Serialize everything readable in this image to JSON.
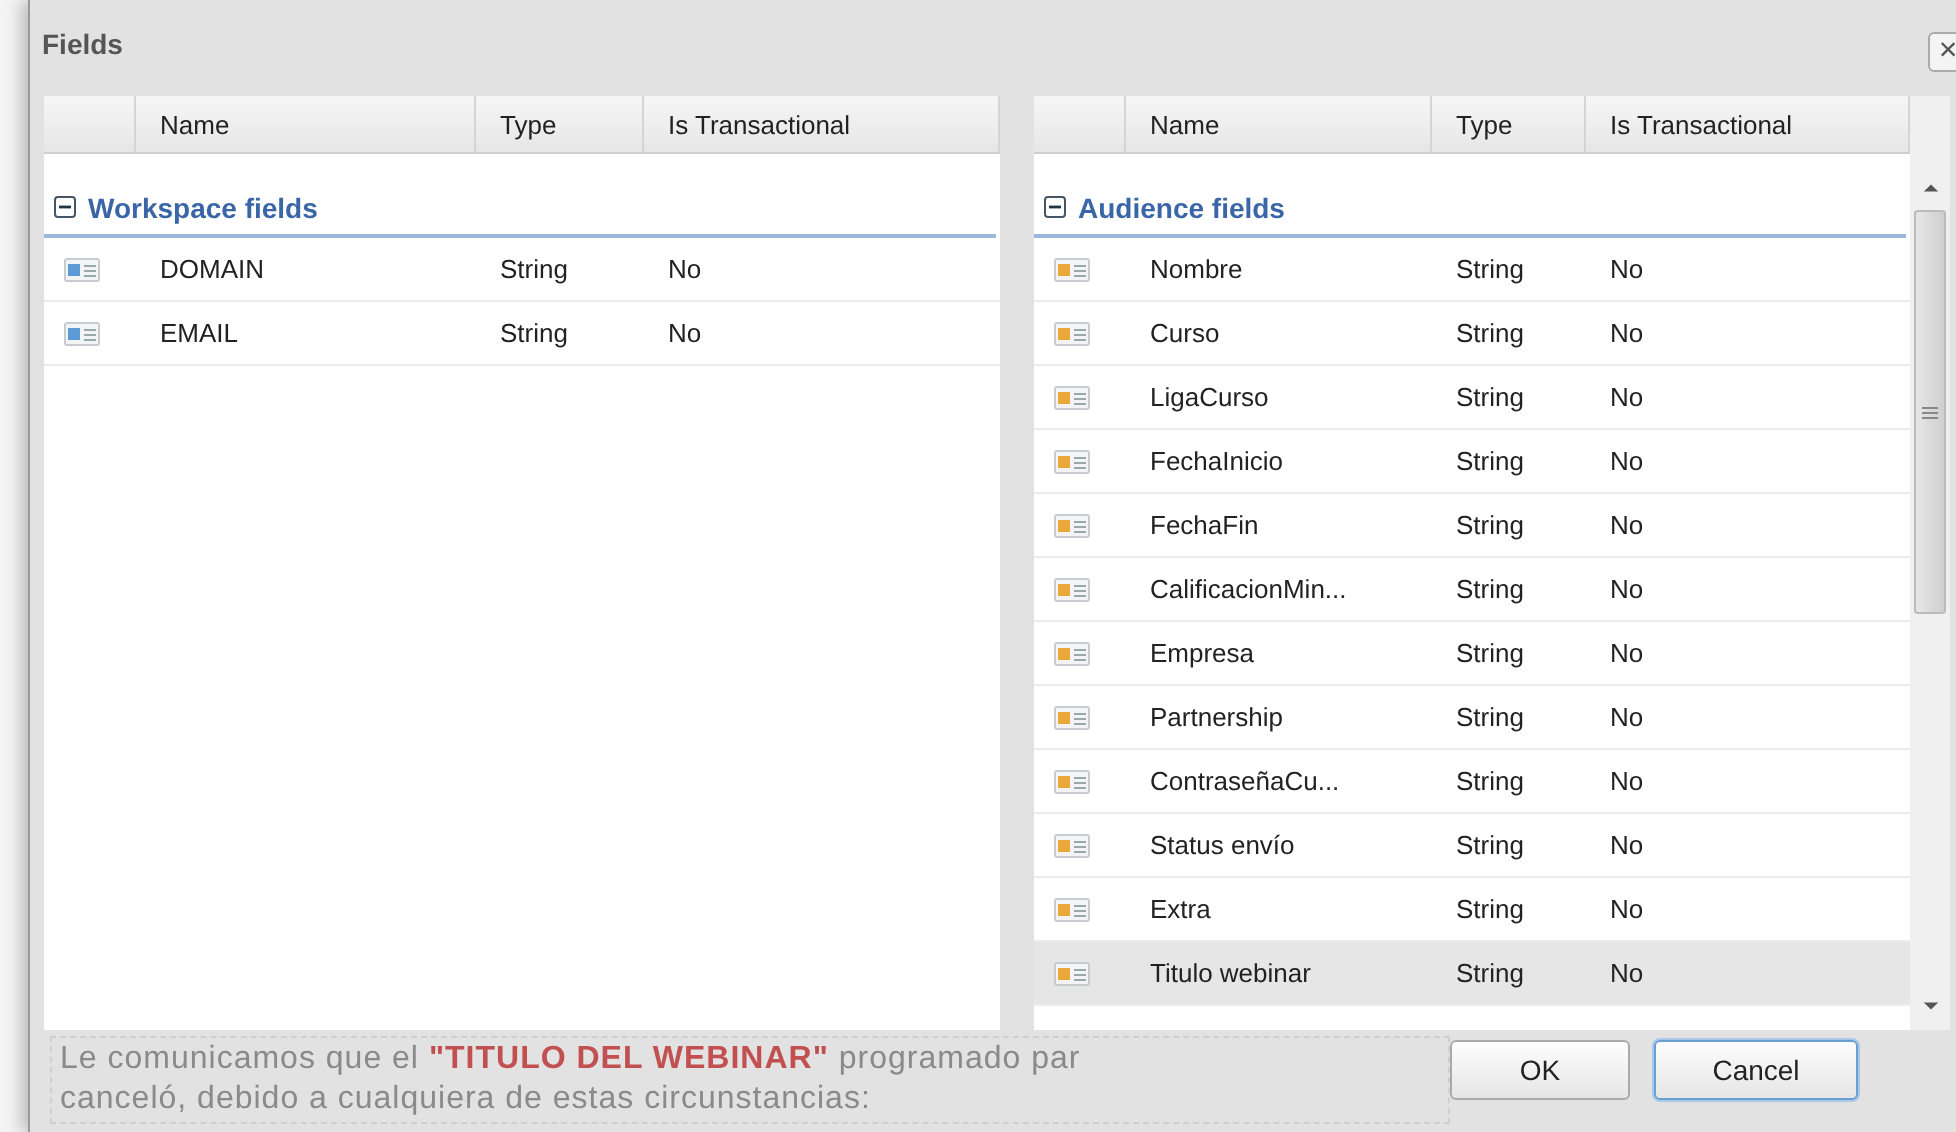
{
  "dialog": {
    "title": "Fields",
    "close": "×"
  },
  "panels": [
    {
      "columns": [
        "Name",
        "Type",
        "Is Transactional"
      ],
      "group": {
        "label": "Workspace fields",
        "expanded": true
      },
      "rows": [
        {
          "name": "DOMAIN",
          "type": "String",
          "transactional": "No",
          "selected": false
        },
        {
          "name": "EMAIL",
          "type": "String",
          "transactional": "No",
          "selected": false
        }
      ]
    },
    {
      "columns": [
        "Name",
        "Type",
        "Is Transactional"
      ],
      "group": {
        "label": "Audience fields",
        "expanded": true
      },
      "rows": [
        {
          "name": "Nombre",
          "type": "String",
          "transactional": "No",
          "selected": false
        },
        {
          "name": "Curso",
          "type": "String",
          "transactional": "No",
          "selected": false
        },
        {
          "name": "LigaCurso",
          "type": "String",
          "transactional": "No",
          "selected": false
        },
        {
          "name": "FechaInicio",
          "type": "String",
          "transactional": "No",
          "selected": false
        },
        {
          "name": "FechaFin",
          "type": "String",
          "transactional": "No",
          "selected": false
        },
        {
          "name": "CalificacionMin...",
          "type": "String",
          "transactional": "No",
          "selected": false
        },
        {
          "name": "Empresa",
          "type": "String",
          "transactional": "No",
          "selected": false
        },
        {
          "name": "Partnership",
          "type": "String",
          "transactional": "No",
          "selected": false
        },
        {
          "name": "ContraseñaCu...",
          "type": "String",
          "transactional": "No",
          "selected": false
        },
        {
          "name": "Status envío",
          "type": "String",
          "transactional": "No",
          "selected": false
        },
        {
          "name": "Extra",
          "type": "String",
          "transactional": "No",
          "selected": false
        },
        {
          "name": "Titulo webinar",
          "type": "String",
          "transactional": "No",
          "selected": true
        }
      ]
    }
  ],
  "background_text": [
    "Le comunicamos que el **\"TITULO DEL WEBINAR\"** programado par",
    "canceló, debido a cualquiera de estas circunstancias:"
  ],
  "buttons": [
    {
      "label": "OK",
      "selected": false
    },
    {
      "label": "Cancel",
      "selected": true
    }
  ]
}
